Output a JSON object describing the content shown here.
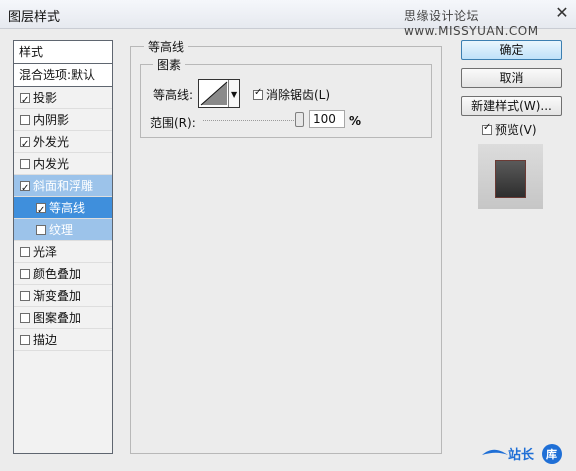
{
  "window": {
    "title": "图层样式",
    "watermark": "思缘设计论坛 www.MISSYUAN.COM",
    "close": "✕"
  },
  "left_panel": {
    "header": "样式",
    "blend_options": "混合选项:默认",
    "items": [
      {
        "label": "投影",
        "checked": true
      },
      {
        "label": "内阴影",
        "checked": false
      },
      {
        "label": "外发光",
        "checked": true
      },
      {
        "label": "内发光",
        "checked": false
      },
      {
        "label": "斜面和浮雕",
        "checked": true
      },
      {
        "label": "等高线",
        "checked": true
      },
      {
        "label": "纹理",
        "checked": false
      },
      {
        "label": "光泽",
        "checked": false
      },
      {
        "label": "颜色叠加",
        "checked": false
      },
      {
        "label": "渐变叠加",
        "checked": false
      },
      {
        "label": "图案叠加",
        "checked": false
      },
      {
        "label": "描边",
        "checked": false
      }
    ]
  },
  "contour_panel": {
    "group_title": "等高线",
    "subgroup_title": "图素",
    "contour_label": "等高线:",
    "antialias_label": "消除锯齿(L)",
    "range_label": "范围(R):",
    "range_value": "100",
    "range_unit": "%"
  },
  "buttons": {
    "ok": "确定",
    "cancel": "取消",
    "new_style": "新建样式(W)...",
    "preview": "预览(V)"
  },
  "logo": {
    "text": "站长",
    "text2": "库"
  }
}
